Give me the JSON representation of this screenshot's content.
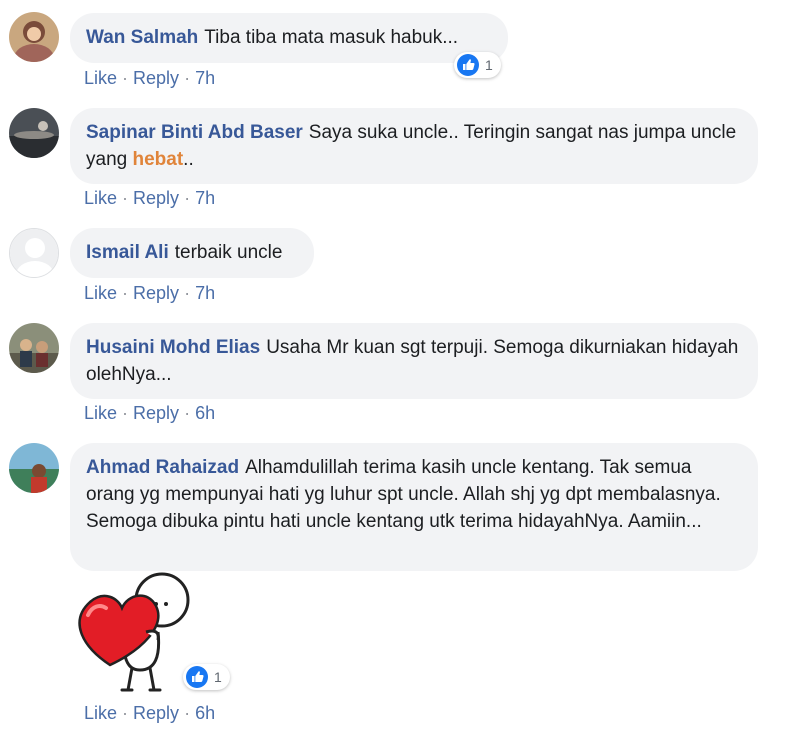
{
  "comments": [
    {
      "author": "Wan Salmah",
      "text": "Tiba tiba mata masuk habuk...",
      "actions": {
        "like": "Like",
        "reply": "Reply",
        "time": "7h"
      },
      "reactions": {
        "icon": "like-icon",
        "count": "1"
      }
    },
    {
      "author": "Sapinar Binti Abd Baser",
      "text_before": "Saya suka uncle.. Teringin sangat nas jumpa uncle yang ",
      "highlight": "hebat",
      "text_after": "..",
      "actions": {
        "like": "Like",
        "reply": "Reply",
        "time": "7h"
      }
    },
    {
      "author": "Ismail Ali",
      "text": "terbaik uncle",
      "actions": {
        "like": "Like",
        "reply": "Reply",
        "time": "7h"
      }
    },
    {
      "author": "Husaini Mohd Elias",
      "text": "Usaha Mr kuan sgt terpuji. Semoga dikurniakan hidayah olehNya...",
      "actions": {
        "like": "Like",
        "reply": "Reply",
        "time": "6h"
      }
    },
    {
      "author": "Ahmad Rahaizad",
      "text": "Alhamdulillah terima kasih uncle kentang. Tak semua orang yg mempunyai hati yg luhur spt uncle. Allah shj yg dpt membalasnya. Semoga dibuka pintu hati uncle kentang utk terima hidayahNya. Aamiin...",
      "actions": {
        "like": "Like",
        "reply": "Reply",
        "time": "6h"
      },
      "sticker": "heart-hug-sticker",
      "reactions": {
        "icon": "like-icon",
        "count": "1"
      }
    }
  ],
  "colors": {
    "author": "#385898",
    "action_link": "#4b6ea8",
    "bubble": "#f2f3f5",
    "highlight": "#e0843a",
    "like_blue": "#1877f2"
  }
}
